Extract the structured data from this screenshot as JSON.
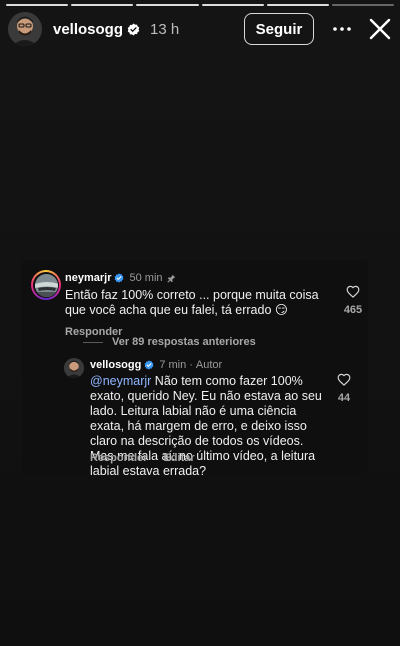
{
  "story": {
    "progress_segments": [
      "active",
      "active",
      "active",
      "active",
      "active",
      "dim"
    ],
    "author": "vellosogg",
    "posted_ago": "13 h",
    "follow_label": "Seguir",
    "more_icon": "more-horizontal-icon",
    "close_icon": "close-icon"
  },
  "comment": {
    "username": "neymarjr",
    "time": "50 min",
    "text": "Então faz 100% correto ... porque muita coisa que você acha que eu falei, tá errado 😏",
    "likes": "465",
    "reply_label": "Responder",
    "view_replies_label": "Ver 89 respostas anteriores"
  },
  "reply": {
    "username": "vellosogg",
    "time": "7 min",
    "author_badge": "Autor",
    "mention": "@neymarjr",
    "text": " Não tem como fazer 100% exato, querido Ney. Eu não estava ao seu lado. Leitura labial não é uma ciência exata, há margem de erro, e deixo isso claro na descrição de todos os vídeos. Mas me fala aí: no último vídeo, a leitura labial estava errada?",
    "likes": "44",
    "reply_label": "Responder",
    "edit_label": "Editar"
  },
  "colors": {
    "background": "#121212",
    "verified": "#3897f0",
    "mention": "#8fb7ff",
    "muted_text": "#a8a8a8"
  }
}
